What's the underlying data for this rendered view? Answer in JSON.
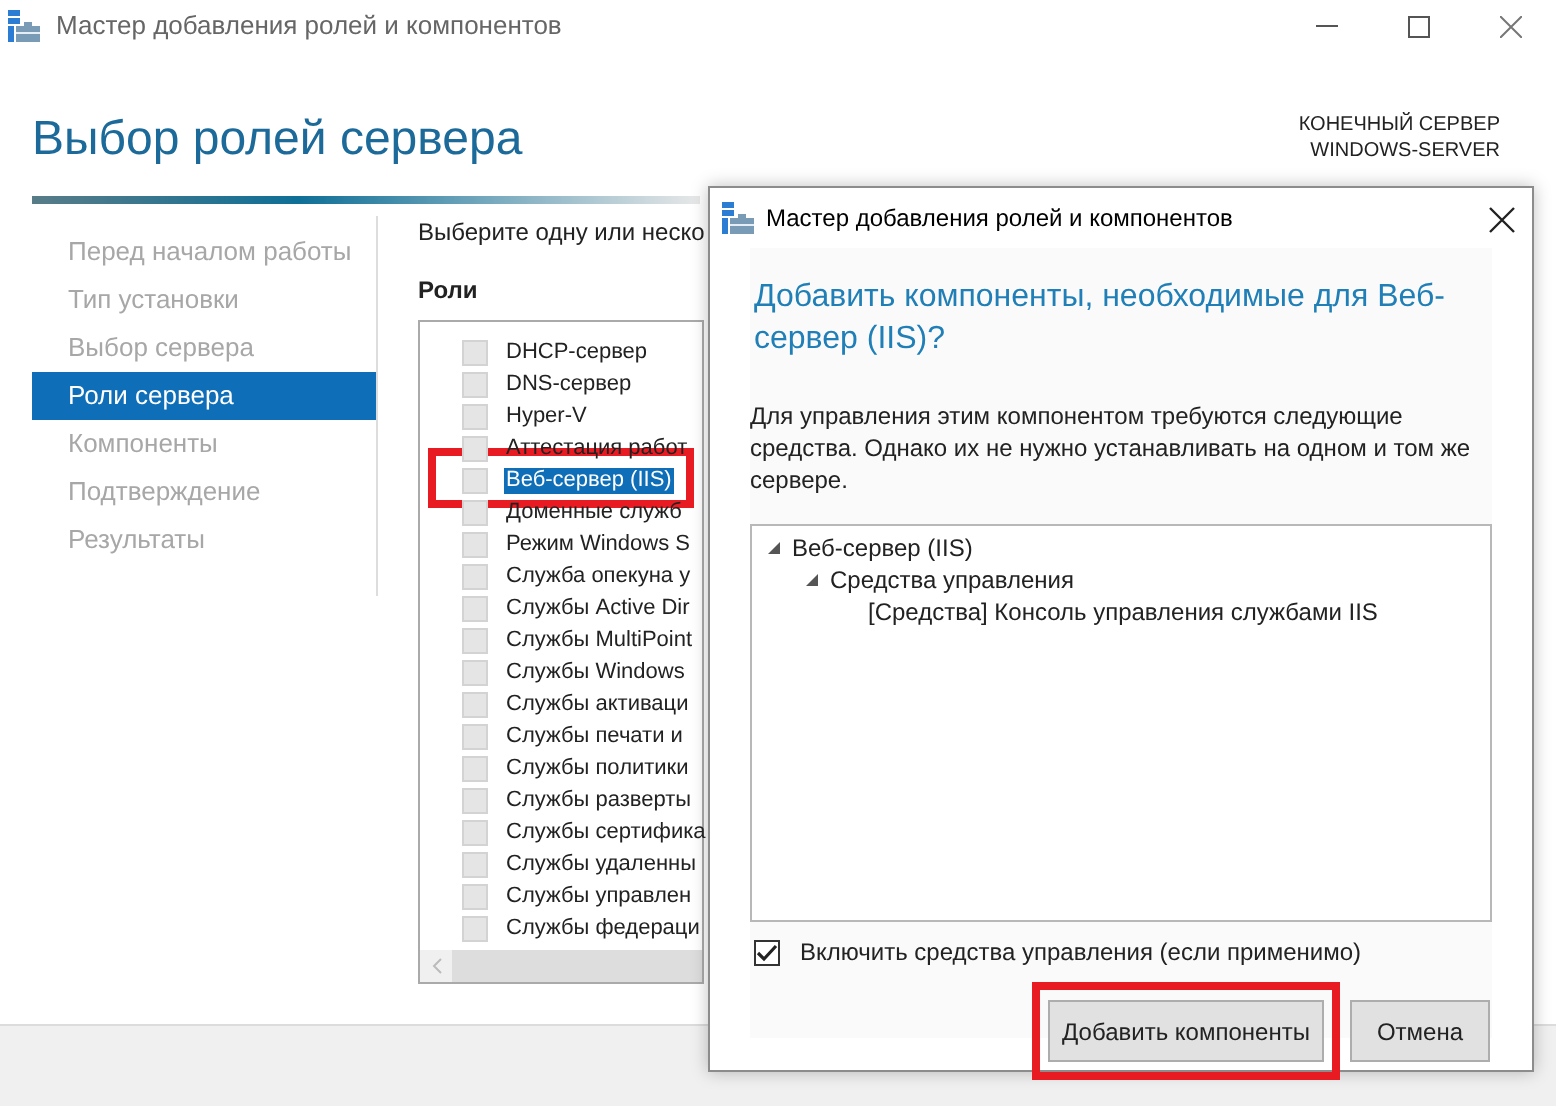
{
  "window": {
    "title": "Мастер добавления ролей и компонентов"
  },
  "page_title": "Выбор ролей сервера",
  "destination": {
    "label": "КОНЕЧНЫЙ СЕРВЕР",
    "server": "WINDOWS-SERVER"
  },
  "steps": [
    {
      "label": "Перед началом работы",
      "selected": false
    },
    {
      "label": "Тип установки",
      "selected": false
    },
    {
      "label": "Выбор сервера",
      "selected": false
    },
    {
      "label": "Роли сервера",
      "selected": true
    },
    {
      "label": "Компоненты",
      "selected": false
    },
    {
      "label": "Подтверждение",
      "selected": false
    },
    {
      "label": "Результаты",
      "selected": false
    }
  ],
  "instruction": "Выберите одну или неско",
  "roles_label": "Роли",
  "roles": [
    {
      "label": "DHCP-сервер",
      "checked": false,
      "selected": false,
      "highlighted": false
    },
    {
      "label": "DNS-сервер",
      "checked": false,
      "selected": false,
      "highlighted": false
    },
    {
      "label": "Hyper-V",
      "checked": false,
      "selected": false,
      "highlighted": false
    },
    {
      "label": "Аттестация работ",
      "checked": false,
      "selected": false,
      "highlighted": false
    },
    {
      "label": "Веб-сервер (IIS)",
      "checked": false,
      "selected": true,
      "highlighted": true
    },
    {
      "label": "Доменные служб",
      "checked": false,
      "selected": false,
      "highlighted": false
    },
    {
      "label": "Режим Windows S",
      "checked": false,
      "selected": false,
      "highlighted": false
    },
    {
      "label": "Служба опекуна у",
      "checked": false,
      "selected": false,
      "highlighted": false
    },
    {
      "label": "Службы Active Dir",
      "checked": false,
      "selected": false,
      "highlighted": false
    },
    {
      "label": "Службы MultiPoint",
      "checked": false,
      "selected": false,
      "highlighted": false
    },
    {
      "label": "Службы Windows",
      "checked": false,
      "selected": false,
      "highlighted": false
    },
    {
      "label": "Службы активаци",
      "checked": false,
      "selected": false,
      "highlighted": false
    },
    {
      "label": "Службы печати и",
      "checked": false,
      "selected": false,
      "highlighted": false
    },
    {
      "label": "Службы политики",
      "checked": false,
      "selected": false,
      "highlighted": false
    },
    {
      "label": "Службы разверты",
      "checked": false,
      "selected": false,
      "highlighted": false
    },
    {
      "label": "Службы сертифика",
      "checked": false,
      "selected": false,
      "highlighted": false
    },
    {
      "label": "Службы удаленны",
      "checked": false,
      "selected": false,
      "highlighted": false
    },
    {
      "label": "Службы управлен",
      "checked": false,
      "selected": false,
      "highlighted": false
    },
    {
      "label": "Службы федераци",
      "checked": false,
      "selected": false,
      "highlighted": false
    }
  ],
  "dialog": {
    "title": "Мастер добавления ролей и компонентов",
    "heading": "Добавить компоненты, необходимые для Веб-сервер (IIS)?",
    "text": "Для управления этим компонентом требуются следующие средства. Однако их не нужно устанавливать на одном и том же сервере.",
    "tree": [
      {
        "label": "Веб-сервер (IIS)",
        "expanded": true,
        "children": [
          {
            "label": "Средства управления",
            "expanded": true,
            "children": [
              {
                "label": "[Средства] Консоль управления службами IIS"
              }
            ]
          }
        ]
      }
    ],
    "include_tools": {
      "label": "Включить средства управления (если применимо)",
      "checked": true
    },
    "buttons": [
      {
        "label": "Добавить компоненты",
        "highlighted": true
      },
      {
        "label": "Отмена",
        "highlighted": false
      }
    ]
  }
}
